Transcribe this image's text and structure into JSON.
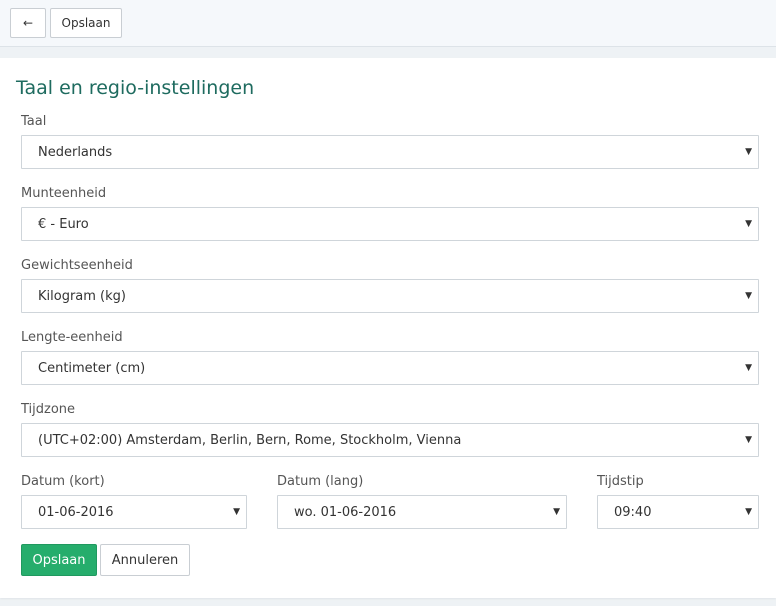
{
  "toolbar": {
    "back_icon": "←",
    "save_label": "Opslaan"
  },
  "page": {
    "title": "Taal en regio-instellingen"
  },
  "fields": {
    "language": {
      "label": "Taal",
      "value": "Nederlands"
    },
    "currency": {
      "label": "Munteenheid",
      "value": "€ - Euro"
    },
    "weight": {
      "label": "Gewichtseenheid",
      "value": "Kilogram (kg)"
    },
    "length": {
      "label": "Lengte-eenheid",
      "value": "Centimeter (cm)"
    },
    "timezone": {
      "label": "Tijdzone",
      "value": "(UTC+02:00) Amsterdam, Berlin, Bern, Rome, Stockholm, Vienna"
    },
    "date_short": {
      "label": "Datum (kort)",
      "value": "01-06-2016"
    },
    "date_long": {
      "label": "Datum (lang)",
      "value": "wo. 01-06-2016"
    },
    "time": {
      "label": "Tijdstip",
      "value": "09:40"
    }
  },
  "icons": {
    "caret": "▼"
  },
  "actions": {
    "save_label": "Opslaan",
    "cancel_label": "Annuleren"
  },
  "colors": {
    "accent": "#26ad6c",
    "title": "#1e6b5f"
  }
}
